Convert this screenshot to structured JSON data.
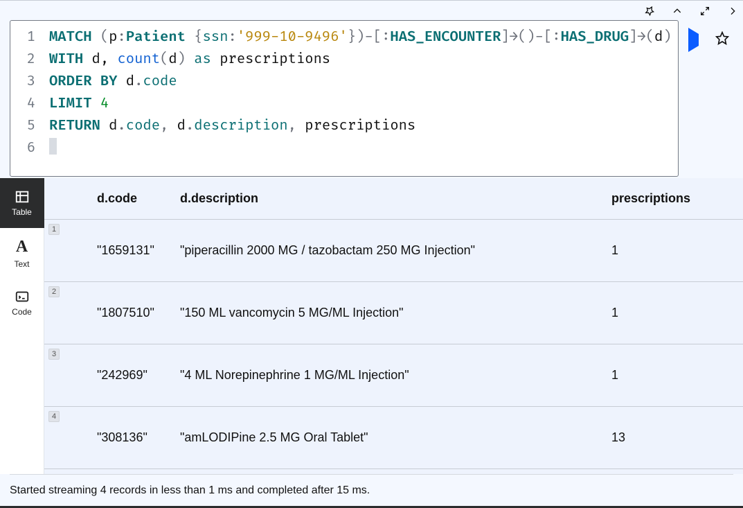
{
  "query": {
    "lines": [
      {
        "n": 1,
        "tokens": [
          {
            "c": "kw",
            "t": "MATCH "
          },
          {
            "c": "punc",
            "t": "("
          },
          {
            "c": "var",
            "t": "p"
          },
          {
            "c": "punc",
            "t": ":"
          },
          {
            "c": "lbl",
            "t": "Patient "
          },
          {
            "c": "punc",
            "t": "{"
          },
          {
            "c": "prop",
            "t": "ssn"
          },
          {
            "c": "punc",
            "t": ":"
          },
          {
            "c": "str",
            "t": "'999-10-9496'"
          },
          {
            "c": "punc",
            "t": "}"
          },
          {
            "c": "punc",
            "t": ")-["
          },
          {
            "c": "punc",
            "t": ":"
          },
          {
            "c": "lbl",
            "t": "HAS_ENCOUNTER"
          },
          {
            "c": "punc",
            "t": "]→()-"
          },
          {
            "c": "punc",
            "t": "[:"
          },
          {
            "c": "lbl",
            "t": "HAS_DRUG"
          },
          {
            "c": "punc",
            "t": "]→("
          },
          {
            "c": "var",
            "t": "d"
          },
          {
            "c": "punc",
            "t": ")"
          }
        ]
      },
      {
        "n": 2,
        "tokens": [
          {
            "c": "kw",
            "t": "WITH "
          },
          {
            "c": "var",
            "t": "d, "
          },
          {
            "c": "fn",
            "t": "count"
          },
          {
            "c": "punc",
            "t": "("
          },
          {
            "c": "var",
            "t": "d"
          },
          {
            "c": "punc",
            "t": ") "
          },
          {
            "c": "as",
            "t": "as "
          },
          {
            "c": "var",
            "t": "prescriptions"
          }
        ]
      },
      {
        "n": 3,
        "tokens": [
          {
            "c": "kw",
            "t": "ORDER BY "
          },
          {
            "c": "var",
            "t": "d"
          },
          {
            "c": "punc",
            "t": "."
          },
          {
            "c": "prop",
            "t": "code"
          }
        ]
      },
      {
        "n": 4,
        "tokens": [
          {
            "c": "kw",
            "t": "LIMIT "
          },
          {
            "c": "num",
            "t": "4"
          }
        ]
      },
      {
        "n": 5,
        "tokens": [
          {
            "c": "kw",
            "t": "RETURN "
          },
          {
            "c": "var",
            "t": "d"
          },
          {
            "c": "punc",
            "t": "."
          },
          {
            "c": "prop",
            "t": "code"
          },
          {
            "c": "punc",
            "t": ", "
          },
          {
            "c": "var",
            "t": "d"
          },
          {
            "c": "punc",
            "t": "."
          },
          {
            "c": "prop",
            "t": "description"
          },
          {
            "c": "punc",
            "t": ", "
          },
          {
            "c": "var",
            "t": "prescriptions"
          }
        ]
      },
      {
        "n": 6,
        "tokens": []
      }
    ]
  },
  "views": [
    {
      "id": "table",
      "label": "Table",
      "active": true
    },
    {
      "id": "text",
      "label": "Text",
      "active": false
    },
    {
      "id": "code",
      "label": "Code",
      "active": false
    }
  ],
  "columns": [
    "d.code",
    "d.description",
    "prescriptions"
  ],
  "rows": [
    {
      "idx": "1",
      "code": "\"1659131\"",
      "description": "\"piperacillin 2000 MG / tazobactam 250 MG Injection\"",
      "prescriptions": "1"
    },
    {
      "idx": "2",
      "code": "\"1807510\"",
      "description": "\"150 ML vancomycin 5 MG/ML Injection\"",
      "prescriptions": "1"
    },
    {
      "idx": "3",
      "code": "\"242969\"",
      "description": "\"4 ML Norepinephrine 1 MG/ML Injection\"",
      "prescriptions": "1"
    },
    {
      "idx": "4",
      "code": "\"308136\"",
      "description": "\"amLODIPine 2.5 MG Oral Tablet\"",
      "prescriptions": "13"
    }
  ],
  "status": "Started streaming 4 records in less than 1 ms and completed after 15 ms.",
  "icons": {
    "pin": "pin-icon",
    "collapse": "chevron-up-icon",
    "expand": "expand-icon",
    "next": "chevron-right-icon",
    "run": "play-icon",
    "star": "star-icon",
    "download": "download-icon"
  }
}
